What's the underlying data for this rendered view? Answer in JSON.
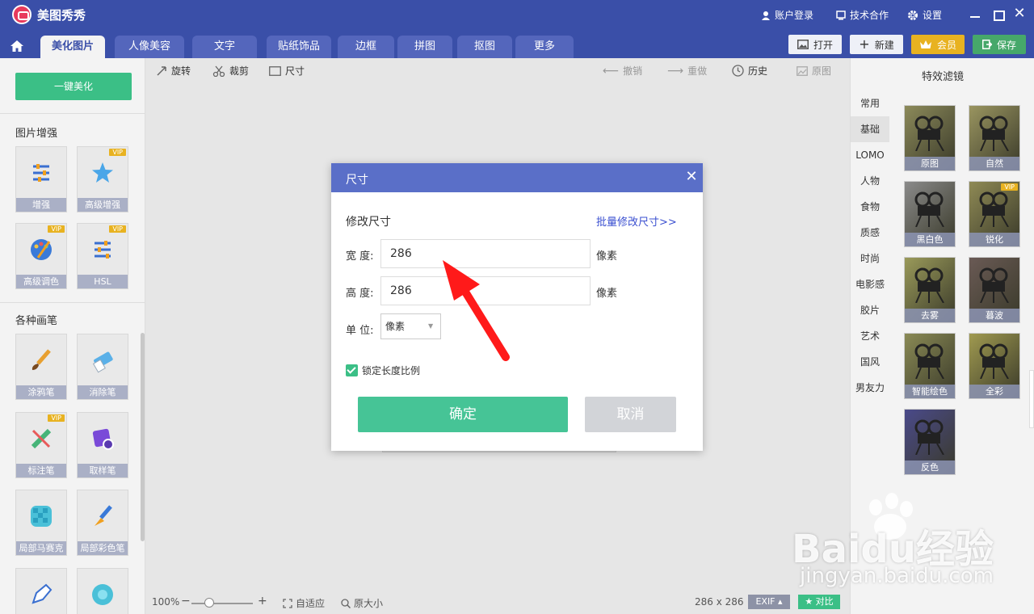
{
  "app": {
    "title": "美图秀秀"
  },
  "titlebar": {
    "account": "账户登录",
    "tech": "技术合作",
    "settings": "设置"
  },
  "tabs": [
    "美化图片",
    "人像美容",
    "文字",
    "贴纸饰品",
    "边框",
    "拼图",
    "抠图",
    "更多"
  ],
  "top_buttons": {
    "open": "打开",
    "new": "新建",
    "vip": "会员",
    "save": "保存"
  },
  "sidebar": {
    "one_key": "一键美化",
    "section_enhance": "图片增强",
    "enhance_tools": [
      {
        "label": "增强",
        "vip": ""
      },
      {
        "label": "高级增强",
        "vip": "VIP"
      },
      {
        "label": "高级调色",
        "vip": "VIP"
      },
      {
        "label": "HSL",
        "vip": "VIP"
      }
    ],
    "section_brush": "各种画笔",
    "brush_tools": [
      {
        "label": "涂鸦笔",
        "vip": ""
      },
      {
        "label": "消除笔",
        "vip": ""
      },
      {
        "label": "标注笔",
        "vip": "VIP"
      },
      {
        "label": "取样笔",
        "vip": ""
      },
      {
        "label": "局部马赛克",
        "vip": ""
      },
      {
        "label": "局部彩色笔",
        "vip": ""
      }
    ]
  },
  "canvas_toolbar": {
    "rotate": "旋转",
    "crop": "裁剪",
    "size": "尺寸",
    "undo": "撤销",
    "redo": "重做",
    "history": "历史",
    "original": "原图"
  },
  "statusbar": {
    "zoom": "100%",
    "fit": "自适应",
    "actual": "原大小",
    "dimensions": "286 x 286",
    "exif": "EXIF",
    "compare": "对比"
  },
  "filters": {
    "title": "特效滤镜",
    "categories": [
      "常用",
      "基础",
      "LOMO",
      "人物",
      "食物",
      "质感",
      "时尚",
      "电影感",
      "胶片",
      "艺术",
      "国风",
      "男友力"
    ],
    "active_category": "基础",
    "thumbs": [
      {
        "label": "原图",
        "vip": "",
        "tone": "#8c8a5a"
      },
      {
        "label": "自然",
        "vip": "",
        "tone": "#9a9560"
      },
      {
        "label": "黑白色",
        "vip": "",
        "tone": "#8a8a8a"
      },
      {
        "label": "锐化",
        "vip": "VIP",
        "tone": "#8f8a55"
      },
      {
        "label": "去雾",
        "vip": "",
        "tone": "#9a9a5a"
      },
      {
        "label": "暮波",
        "vip": "",
        "tone": "#6a5a55"
      },
      {
        "label": "智能绘色",
        "vip": "",
        "tone": "#8a8a55"
      },
      {
        "label": "全彩",
        "vip": "",
        "tone": "#a09a50"
      },
      {
        "label": "反色",
        "vip": "",
        "tone": "#4a4a8a"
      }
    ]
  },
  "dialog": {
    "title": "尺寸",
    "section": "修改尺寸",
    "batch_link": "批量修改尺寸>>",
    "width_label": "宽 度:",
    "width_value": "286",
    "height_label": "高 度:",
    "height_value": "286",
    "unit_px": "像素",
    "unit_label": "单 位:",
    "unit_value": "像素",
    "lock_ratio": "锁定长度比例",
    "ok": "确定",
    "cancel": "取消"
  },
  "watermark": {
    "brand": "Baidu经验",
    "url": "jingyan.baidu.com"
  },
  "colors": {
    "brand": "#3a4fa8",
    "accent_green": "#46c496",
    "vip_gold": "#e8b220",
    "link_blue": "#3a4fd0",
    "arrow_red": "#ff1a1a"
  }
}
